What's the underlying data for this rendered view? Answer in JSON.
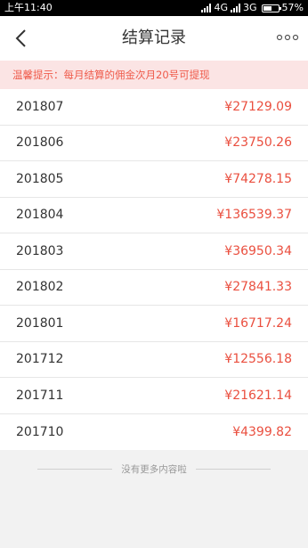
{
  "status_bar": {
    "time": "上午11:40",
    "network_1": "4G",
    "network_2": "3G",
    "battery_percent": "57%",
    "battery_level": 0.57
  },
  "header": {
    "title": "结算记录",
    "back_icon": "back-chevron-icon",
    "more_icon": "more-dots-icon"
  },
  "tip": "温馨提示：每月结算的佣金次月20号可提现",
  "colors": {
    "accent": "#ea4f3f",
    "tip_background": "#fbe4e4"
  },
  "records": [
    {
      "month": "201807",
      "amount": "¥27129.09"
    },
    {
      "month": "201806",
      "amount": "¥23750.26"
    },
    {
      "month": "201805",
      "amount": "¥74278.15"
    },
    {
      "month": "201804",
      "amount": "¥136539.37"
    },
    {
      "month": "201803",
      "amount": "¥36950.34"
    },
    {
      "month": "201802",
      "amount": "¥27841.33"
    },
    {
      "month": "201801",
      "amount": "¥16717.24"
    },
    {
      "month": "201712",
      "amount": "¥12556.18"
    },
    {
      "month": "201711",
      "amount": "¥21621.14"
    },
    {
      "month": "201710",
      "amount": "¥4399.82"
    }
  ],
  "end_text": "没有更多内容啦"
}
